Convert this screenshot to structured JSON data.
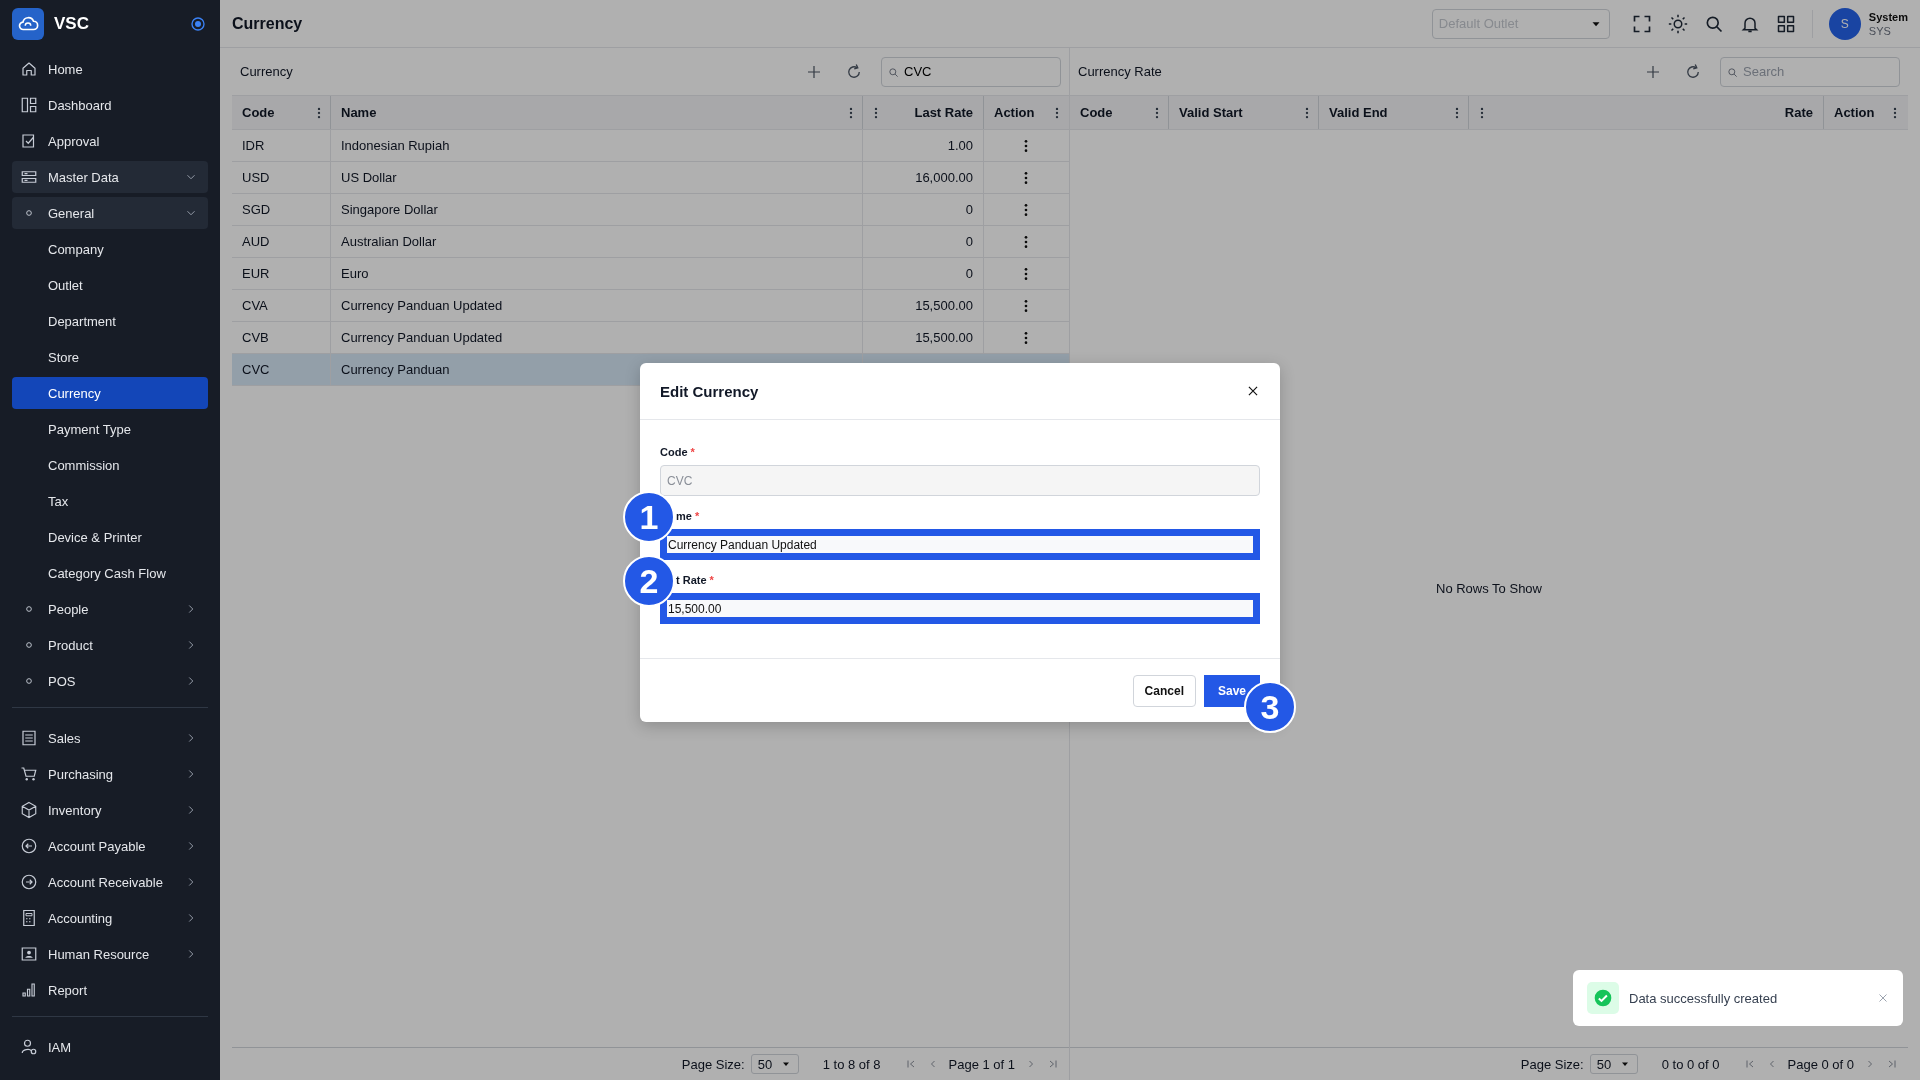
{
  "sidebar": {
    "brand": "VSC",
    "items": [
      {
        "label": "Home"
      },
      {
        "label": "Dashboard"
      },
      {
        "label": "Approval"
      },
      {
        "label": "Master Data",
        "expanded": true,
        "children": [
          {
            "label": "General",
            "expanded": true,
            "children": [
              {
                "label": "Company",
                "selected": false
              },
              {
                "label": "Outlet",
                "selected": false
              },
              {
                "label": "Department",
                "selected": false
              },
              {
                "label": "Store",
                "selected": false
              },
              {
                "label": "Currency",
                "selected": true
              },
              {
                "label": "Payment Type",
                "selected": false
              },
              {
                "label": "Commission",
                "selected": false
              },
              {
                "label": "Tax",
                "selected": false
              },
              {
                "label": "Device & Printer",
                "selected": false
              },
              {
                "label": "Category Cash Flow",
                "selected": false
              }
            ]
          },
          {
            "label": "People",
            "expanded": false
          },
          {
            "label": "Product",
            "expanded": false
          },
          {
            "label": "POS",
            "expanded": false
          }
        ]
      }
    ],
    "modules": [
      {
        "label": "Sales",
        "expanded": false
      },
      {
        "label": "Purchasing",
        "expanded": false
      },
      {
        "label": "Inventory",
        "expanded": false
      },
      {
        "label": "Account Payable",
        "expanded": false
      },
      {
        "label": "Account Receivable",
        "expanded": false
      },
      {
        "label": "Accounting",
        "expanded": false
      },
      {
        "label": "Human Resource",
        "expanded": false
      },
      {
        "label": "Report"
      }
    ],
    "admin": [
      {
        "label": "IAM"
      }
    ]
  },
  "header": {
    "title": "Currency",
    "outlet": {
      "placeholder": "Default Outlet"
    },
    "user": {
      "initial": "S",
      "name": "System",
      "code": "SYS"
    }
  },
  "panels": [
    {
      "title": "Currency",
      "search": {
        "value": "CVC"
      },
      "columns": [
        {
          "label": "Code",
          "kind": "text"
        },
        {
          "label": "Name",
          "kind": "text"
        },
        {
          "label": "Last Rate",
          "kind": "numeric"
        },
        {
          "label": "Action",
          "kind": "text"
        }
      ],
      "rows": [
        {
          "cells": [
            "IDR",
            "Indonesian Rupiah",
            "1.00"
          ],
          "selected": false
        },
        {
          "cells": [
            "USD",
            "US Dollar",
            "16,000.00"
          ],
          "selected": false
        },
        {
          "cells": [
            "SGD",
            "Singapore Dollar",
            "0"
          ],
          "selected": false
        },
        {
          "cells": [
            "AUD",
            "Australian Dollar",
            "0"
          ],
          "selected": false
        },
        {
          "cells": [
            "EUR",
            "Euro",
            "0"
          ],
          "selected": false
        },
        {
          "cells": [
            "CVA",
            "Currency Panduan Updated",
            "15,500.00"
          ],
          "selected": false
        },
        {
          "cells": [
            "CVB",
            "Currency Panduan Updated",
            "15,500.00"
          ],
          "selected": false
        },
        {
          "cells": [
            "CVC",
            "Currency Panduan"
          ],
          "selected": true
        }
      ],
      "pagination": {
        "page_size_label": "Page Size:",
        "page_size": "50",
        "range": "1 to 8 of 8",
        "page": "Page 1 of 1"
      }
    },
    {
      "title": "Currency Rate",
      "search": {
        "placeholder": "Search"
      },
      "columns": [
        {
          "label": "Code",
          "kind": "text"
        },
        {
          "label": "Valid Start",
          "kind": "text"
        },
        {
          "label": "Valid End",
          "kind": "text"
        },
        {
          "label": "Rate",
          "kind": "numeric"
        },
        {
          "label": "Action",
          "kind": "text"
        }
      ],
      "empty_message": "No Rows To Show",
      "pagination": {
        "page_size_label": "Page Size:",
        "page_size": "50",
        "range": "0 to 0 of 0",
        "page": "Page 0 of 0"
      }
    }
  ],
  "dialog": {
    "title": "Edit Currency",
    "fields": [
      {
        "label": "Code",
        "required_mark": "*",
        "value": "CVC",
        "disabled": true,
        "highlighted": false
      },
      {
        "label": "me",
        "required_mark": "*",
        "value": "Currency Panduan Updated",
        "disabled": false,
        "highlighted": true
      },
      {
        "label": "t Rate",
        "required_mark": "*",
        "value": "15,500.00",
        "disabled": false,
        "highlighted": true
      }
    ],
    "buttons": [
      {
        "label": "Cancel",
        "kind": "secondary"
      },
      {
        "label": "Save",
        "kind": "primary"
      }
    ],
    "annotations": [
      {
        "number": "1"
      },
      {
        "number": "2"
      },
      {
        "number": "3"
      }
    ]
  },
  "toast": {
    "message": "Data successfully created",
    "kind": "success"
  }
}
